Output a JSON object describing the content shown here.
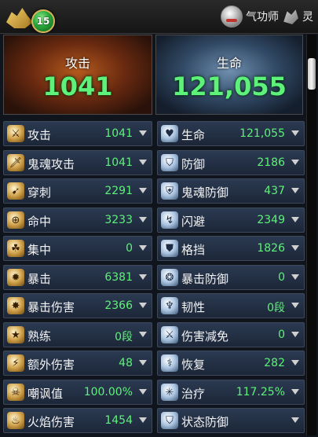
{
  "header": {
    "level": "15",
    "class_name": "气功师",
    "class_suffix": "灵"
  },
  "panels": {
    "attack": {
      "title": "攻击",
      "value": "1041"
    },
    "health": {
      "title": "生命",
      "value": "121,055"
    }
  },
  "stats_left": [
    {
      "label": "攻击",
      "value": "1041",
      "icon": "crossed-swords-icon"
    },
    {
      "label": "鬼魂攻击",
      "value": "1041",
      "icon": "ghost-sword-icon"
    },
    {
      "label": "穿刺",
      "value": "2291",
      "icon": "pierce-icon"
    },
    {
      "label": "命中",
      "value": "3233",
      "icon": "target-icon"
    },
    {
      "label": "集中",
      "value": "0",
      "icon": "focus-icon"
    },
    {
      "label": "暴击",
      "value": "6381",
      "icon": "critical-burst-icon"
    },
    {
      "label": "暴击伤害",
      "value": "2366",
      "icon": "critical-damage-icon"
    },
    {
      "label": "熟练",
      "value": "0段",
      "icon": "mastery-star-icon"
    },
    {
      "label": "额外伤害",
      "value": "48",
      "icon": "extra-damage-icon"
    },
    {
      "label": "嘲讽值",
      "value": "100.00%",
      "icon": "taunt-skull-icon"
    },
    {
      "label": "火焰伤害",
      "value": "1454",
      "icon": "flame-icon"
    }
  ],
  "stats_right": [
    {
      "label": "生命",
      "value": "121,055",
      "icon": "heart-icon"
    },
    {
      "label": "防御",
      "value": "2186",
      "icon": "shield-icon"
    },
    {
      "label": "鬼魂防御",
      "value": "437",
      "icon": "ghost-shield-icon"
    },
    {
      "label": "闪避",
      "value": "2349",
      "icon": "evade-icon"
    },
    {
      "label": "格挡",
      "value": "1826",
      "icon": "block-icon"
    },
    {
      "label": "暴击防御",
      "value": "0",
      "icon": "critical-defense-icon"
    },
    {
      "label": "韧性",
      "value": "0段",
      "icon": "toughness-icon"
    },
    {
      "label": "伤害减免",
      "value": "0",
      "icon": "damage-reduction-icon"
    },
    {
      "label": "恢复",
      "value": "282",
      "icon": "recovery-icon"
    },
    {
      "label": "治疗",
      "value": "117.25%",
      "icon": "healing-icon"
    },
    {
      "label": "状态防御",
      "value": "",
      "icon": "status-defense-icon"
    }
  ],
  "icons_glyph": {
    "crossed-swords-icon": "⚔",
    "ghost-sword-icon": "🗡",
    "pierce-icon": "➹",
    "target-icon": "⊕",
    "focus-icon": "☘",
    "critical-burst-icon": "✹",
    "critical-damage-icon": "✸",
    "mastery-star-icon": "★",
    "extra-damage-icon": "⚡",
    "taunt-skull-icon": "☠",
    "flame-icon": "♨",
    "heart-icon": "♥",
    "shield-icon": "⛉",
    "ghost-shield-icon": "⛨",
    "evade-icon": "↯",
    "block-icon": "⛊",
    "critical-defense-icon": "❂",
    "toughness-icon": "♆",
    "damage-reduction-icon": "⚔",
    "recovery-icon": "⚕",
    "healing-icon": "✳",
    "status-defense-icon": "⛉"
  },
  "colors": {
    "value_green": "#5ef27a",
    "row_bg_top": "#2b3a52",
    "row_bg_bottom": "#1c2638"
  }
}
